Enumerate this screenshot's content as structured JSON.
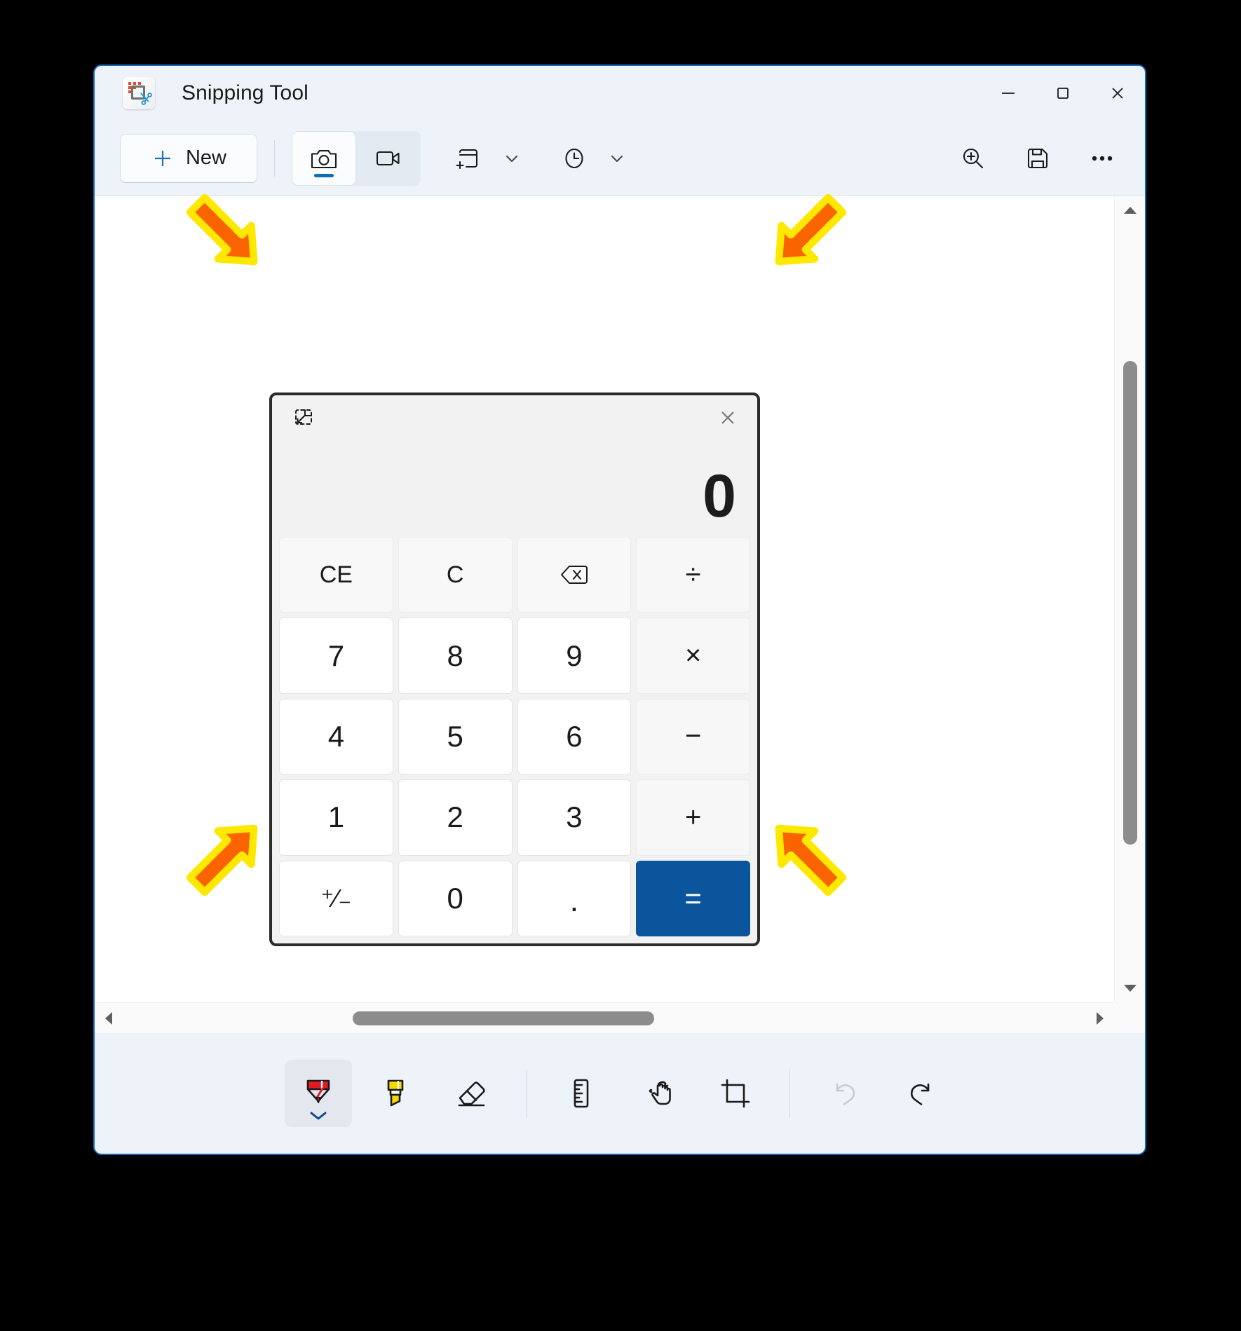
{
  "window": {
    "title": "Snipping Tool",
    "app_icon_name": "snipping-tool-icon",
    "controls": {
      "minimize": "—",
      "maximize": "□",
      "close": "✕"
    },
    "accent_color": "#1569b8",
    "titlebar_bg": "#eef3f9"
  },
  "toolbar": {
    "new_label": "New",
    "mode_screenshot": "screenshot-camera-mode",
    "mode_record": "video-record-mode",
    "window_snip": "window-snip",
    "window_snip_chevron": "chevron-down",
    "delay": "delay-timer",
    "delay_chevron": "chevron-down",
    "zoom": "zoom-in",
    "save": "save-floppy",
    "more": "more-options-ellipsis"
  },
  "calculator": {
    "restore_icon": "exit-always-on-top",
    "close_icon": "close",
    "display_value": "0",
    "accent_color": "#0b559c",
    "keys": [
      {
        "label": "CE",
        "type": "fn",
        "name": "key-clear-entry"
      },
      {
        "label": "C",
        "type": "fn",
        "name": "key-clear"
      },
      {
        "label": "",
        "type": "fn",
        "name": "key-backspace",
        "icon": "backspace"
      },
      {
        "label": "÷",
        "type": "op",
        "name": "key-divide"
      },
      {
        "label": "7",
        "type": "num",
        "name": "key-7"
      },
      {
        "label": "8",
        "type": "num",
        "name": "key-8"
      },
      {
        "label": "9",
        "type": "num",
        "name": "key-9"
      },
      {
        "label": "×",
        "type": "op",
        "name": "key-multiply"
      },
      {
        "label": "4",
        "type": "num",
        "name": "key-4"
      },
      {
        "label": "5",
        "type": "num",
        "name": "key-5"
      },
      {
        "label": "6",
        "type": "num",
        "name": "key-6"
      },
      {
        "label": "−",
        "type": "op",
        "name": "key-subtract"
      },
      {
        "label": "1",
        "type": "num",
        "name": "key-1"
      },
      {
        "label": "2",
        "type": "num",
        "name": "key-2"
      },
      {
        "label": "3",
        "type": "num",
        "name": "key-3"
      },
      {
        "label": "+",
        "type": "op",
        "name": "key-add"
      },
      {
        "label": "⁺⁄₋",
        "type": "pm",
        "name": "key-plus-minus"
      },
      {
        "label": "0",
        "type": "num",
        "name": "key-0"
      },
      {
        "label": ".",
        "type": "dot",
        "name": "key-decimal"
      },
      {
        "label": "=",
        "type": "eq",
        "name": "key-equals"
      }
    ]
  },
  "tools": {
    "ballpoint": "ballpoint-pen",
    "highlighter": "highlighter",
    "eraser": "eraser",
    "ruler": "ruler",
    "touch_writing": "touch-writing",
    "crop": "crop",
    "undo": "undo",
    "redo": "redo"
  },
  "scrollbars": {
    "vertical_up": "scroll-up-arrow",
    "vertical_down": "scroll-down-arrow",
    "horizontal_left": "scroll-left-arrow",
    "horizontal_right": "scroll-right-arrow"
  },
  "annotations": {
    "arrow_color": "#fa6400",
    "arrow_outline": "#ffe800",
    "count": 4,
    "purpose": "corner-markers-on-snip-selection"
  }
}
